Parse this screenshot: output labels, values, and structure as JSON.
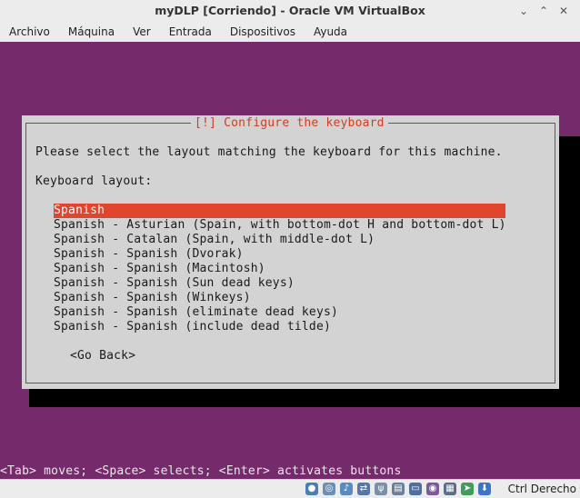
{
  "window": {
    "title": "myDLP [Corriendo] - Oracle VM VirtualBox",
    "minimize_glyph": "⌄",
    "restore_glyph": "⌃",
    "close_glyph": "✕"
  },
  "menu": [
    "Archivo",
    "Máquina",
    "Ver",
    "Entrada",
    "Dispositivos",
    "Ayuda"
  ],
  "installer": {
    "dialog_title": "[!] Configure the keyboard",
    "prompt": "Please select the layout matching the keyboard for this machine.",
    "list_label": "Keyboard layout:",
    "options": [
      "Spanish",
      "Spanish - Asturian (Spain, with bottom-dot H and bottom-dot L)",
      "Spanish - Catalan (Spain, with middle-dot L)",
      "Spanish - Spanish (Dvorak)",
      "Spanish - Spanish (Macintosh)",
      "Spanish - Spanish (Sun dead keys)",
      "Spanish - Spanish (Winkeys)",
      "Spanish - Spanish (eliminate dead keys)",
      "Spanish - Spanish (include dead tilde)"
    ],
    "selected_index": 0,
    "go_back": "<Go Back>",
    "hint": "<Tab> moves; <Space> selects; <Enter> activates buttons"
  },
  "statusbar": {
    "host_key": "Ctrl Derecho",
    "icons": [
      "hard-disk-icon",
      "optical-drive-icon",
      "audio-icon",
      "network-icon",
      "usb-icon",
      "shared-folders-icon",
      "display-icon",
      "video-capture-icon",
      "cpu-icon",
      "mouse-integration-icon",
      "keyboard-capture-icon"
    ]
  },
  "colors": {
    "screen_bg": "#752a6b",
    "dialog_bg": "#d3d3d3",
    "dialog_title": "#cf3e28",
    "selection": "#e0452e"
  }
}
